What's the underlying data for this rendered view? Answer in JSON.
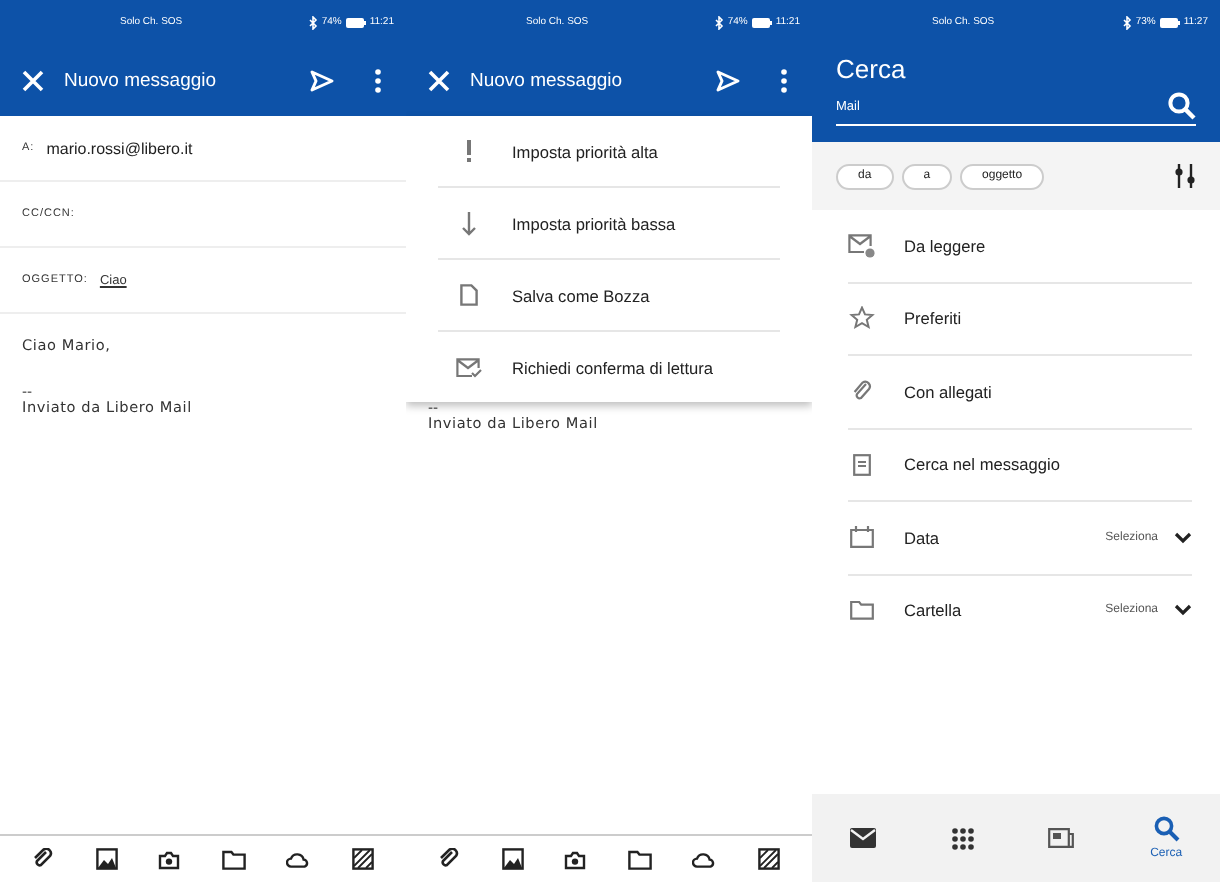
{
  "compose": {
    "status": {
      "carrier": "Solo Ch. SOS",
      "battery": "74%",
      "time": "11:21"
    },
    "title": "Nuovo messaggio",
    "fields": [
      {
        "kind": "recipient",
        "label": "A:",
        "value": "mario.rossi@libero.it"
      },
      {
        "kind": "recipient",
        "label": "CC/CCN:"
      },
      {
        "kind": "subject",
        "label": "OGGETTO:",
        "value": "Ciao"
      }
    ],
    "body": "Ciao Mario,",
    "signature_sep": "--",
    "signature": "Inviato da Libero Mail"
  },
  "compose_menu": {
    "status": {
      "carrier": "Solo Ch. SOS",
      "battery": "74%",
      "time": "11:21"
    },
    "title": "Nuovo messaggio",
    "menu": [
      {
        "label": "Imposta priorità alta"
      },
      {
        "label": "Imposta priorità bassa"
      },
      {
        "label": "Salva come Bozza"
      },
      {
        "label": "Richiedi conferma di lettura"
      }
    ],
    "signature_sep": "--",
    "signature": "Inviato da Libero Mail"
  },
  "search": {
    "status": {
      "carrier": "Solo Ch. SOS",
      "battery": "73%",
      "time": "11:27"
    },
    "title": "Cerca",
    "query": "Mail",
    "chips": [
      "da",
      "a",
      "oggetto"
    ],
    "filters": [
      {
        "label": "Da leggere"
      },
      {
        "label": "Preferiti"
      },
      {
        "label": "Con allegati"
      },
      {
        "label": "Cerca nel messaggio"
      },
      {
        "label": "Data",
        "value": "Seleziona"
      },
      {
        "label": "Cartella",
        "value": "Seleziona"
      }
    ],
    "nav": [
      {
        "selected": false
      },
      {
        "selected": false
      },
      {
        "selected": false
      },
      {
        "selected": true,
        "label": "Cerca"
      }
    ]
  }
}
